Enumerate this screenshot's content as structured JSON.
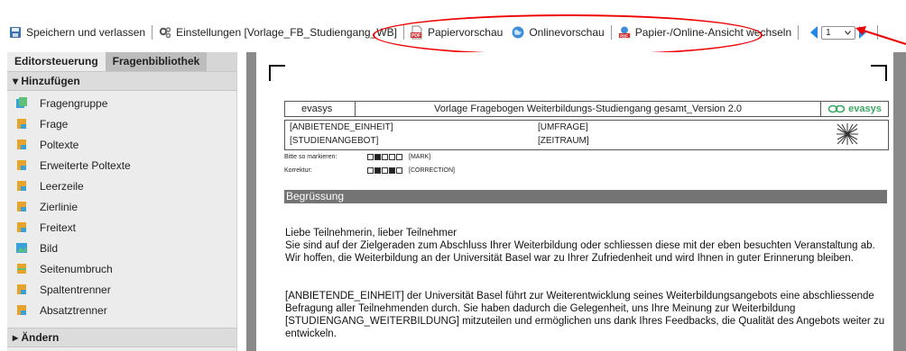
{
  "toolbar": {
    "save_label": "Speichern und verlassen",
    "settings_label": "Einstellungen [Vorlage_FB_Studiengang_WB]",
    "paper_preview_label": "Papiervorschau",
    "online_preview_label": "Onlinevorschau",
    "switch_view_label": "Papier-/Online-Ansicht wechseln",
    "page_number": "1"
  },
  "sidebar": {
    "tabs": [
      {
        "label": "Editorsteuerung"
      },
      {
        "label": "Fragenbibliothek"
      }
    ],
    "add_section": "▾ Hinzufügen",
    "items": [
      {
        "label": "Fragengruppe"
      },
      {
        "label": "Frage"
      },
      {
        "label": "Poltexte"
      },
      {
        "label": "Erweiterte Poltexte"
      },
      {
        "label": "Leerzeile"
      },
      {
        "label": "Zierlinie"
      },
      {
        "label": "Freitext"
      },
      {
        "label": "Bild"
      },
      {
        "label": "Seitenumbruch"
      },
      {
        "label": "Spaltentrenner"
      },
      {
        "label": "Absatztrenner"
      }
    ],
    "change_section": "▸ Ändern"
  },
  "document": {
    "header_left": "evasys",
    "header_title": "Vorlage Fragebogen Weiterbildungs-Studiengang gesamt_Version 2.0",
    "header_logo": "evasys",
    "field_anbietende": "[ANBIETENDE_EINHEIT]",
    "field_umfrage": "[UMFRAGE]",
    "field_studienangebot": "[STUDIENANGEBOT]",
    "field_zeitraum": "[ZEITRAUM]",
    "mark_label": "Bitte so markieren:",
    "mark_tag": "[MARK]",
    "correction_label": "Korrektur:",
    "correction_tag": "[CORRECTION]",
    "section_title": "Begrüssung",
    "para1_line1": "Liebe Teilnehmerin, lieber Teilnehmer",
    "para1_line2": "Sie sind auf der Zielgeraden zum Abschluss Ihrer Weiterbildung oder schliessen diese mit der eben besuchten Veranstaltung ab. Wir hoffen, die Weiterbildung an der Universität Basel war zu Ihrer Zufriedenheit und wird Ihnen in guter Erinnerung bleiben.",
    "para2": "[ANBIETENDE_EINHEIT] der Universität Basel führt zur Weiterentwicklung seines Weiterbildungsangebots eine abschliessende Befragung aller Teilnehmenden durch. Sie haben dadurch die Gelegenheit, uns Ihre Meinung zur Weiterbildung [STUDIENGANG_WEITERBILDUNG] mitzuteilen und ermöglichen uns dank Ihres Feedbacks, die Qualität des Angebots weiter zu entwickeln."
  },
  "colors": {
    "accent_blue": "#1f88e0",
    "annotation_red": "#e00000",
    "section_gray": "#747474",
    "evasys_green": "#3aa860"
  }
}
